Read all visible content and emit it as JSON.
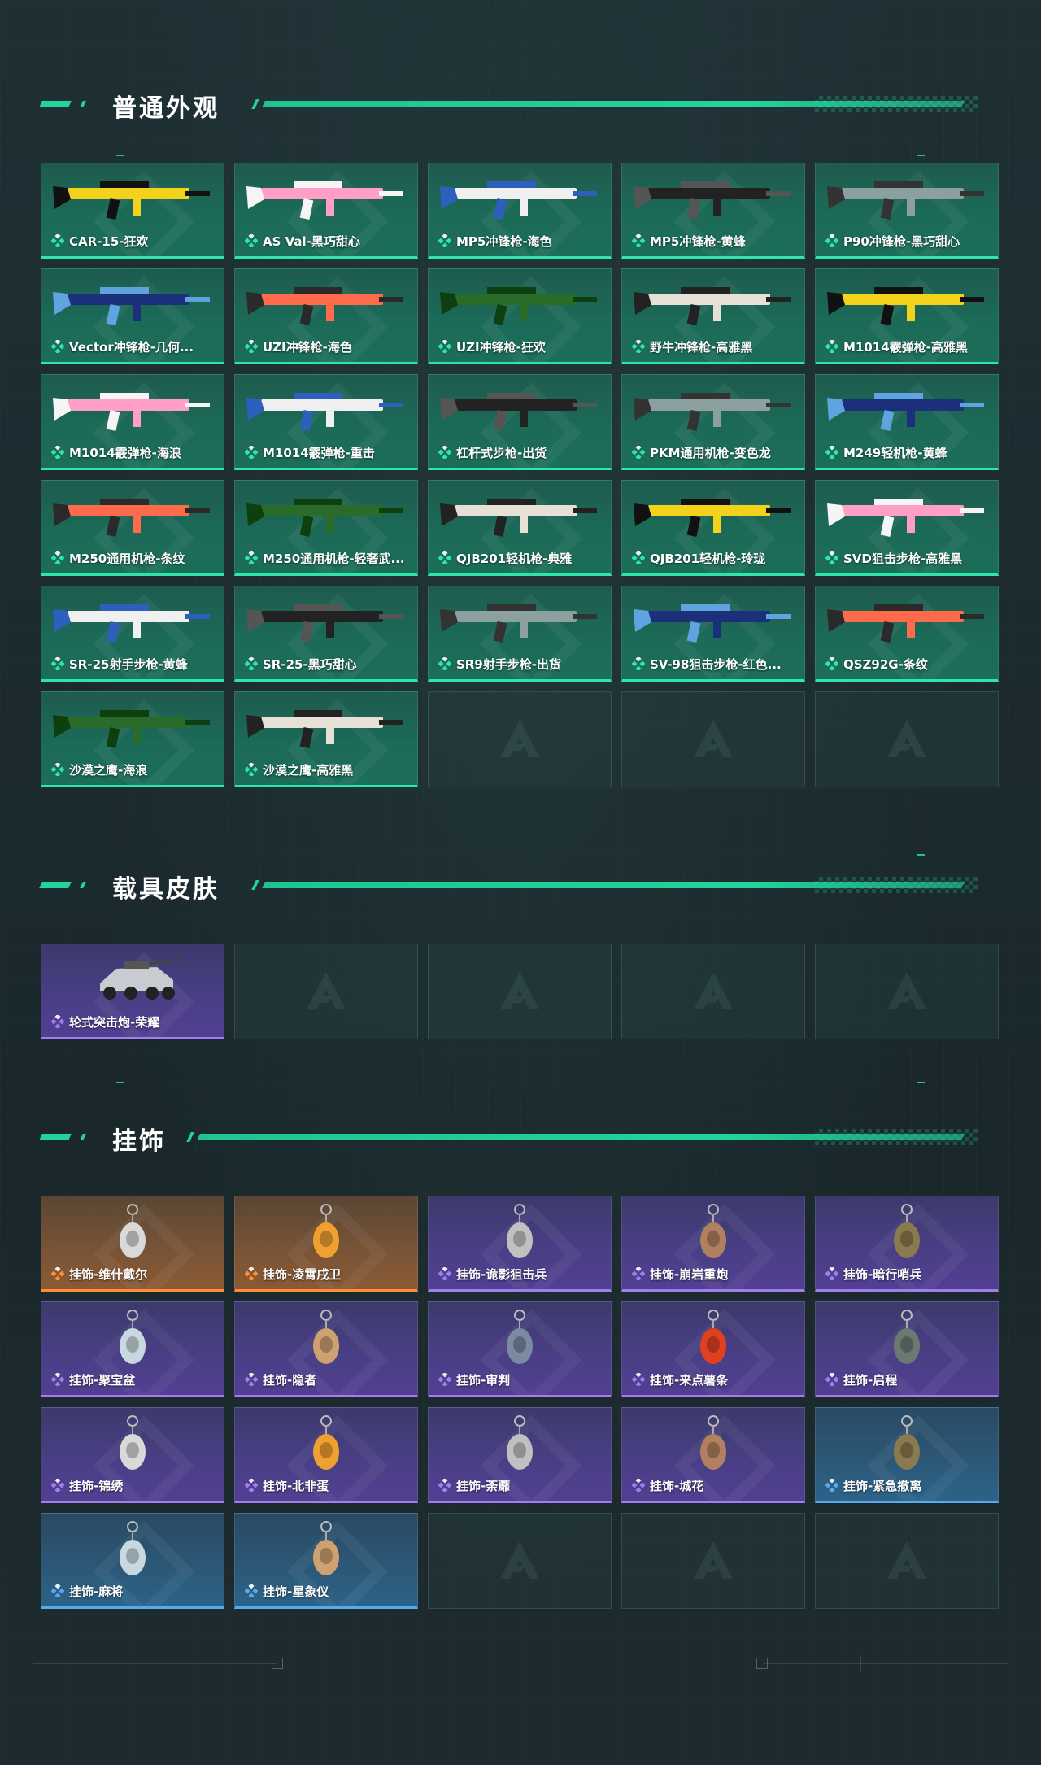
{
  "sections": [
    {
      "title": "普通外观",
      "items": [
        {
          "label": "CAR-15-狂欢",
          "rarity": "green"
        },
        {
          "label": "AS Val-黑巧甜心",
          "rarity": "green"
        },
        {
          "label": "MP5冲锋枪-海色",
          "rarity": "green"
        },
        {
          "label": "MP5冲锋枪-黄蜂",
          "rarity": "green"
        },
        {
          "label": "P90冲锋枪-黑巧甜心",
          "rarity": "green"
        },
        {
          "label": "Vector冲锋枪-几何...",
          "rarity": "green"
        },
        {
          "label": "UZI冲锋枪-海色",
          "rarity": "green"
        },
        {
          "label": "UZI冲锋枪-狂欢",
          "rarity": "green"
        },
        {
          "label": "野牛冲锋枪-高雅黑",
          "rarity": "green"
        },
        {
          "label": "M1014霰弹枪-高雅黑",
          "rarity": "green"
        },
        {
          "label": "M1014霰弹枪-海浪",
          "rarity": "green"
        },
        {
          "label": "M1014霰弹枪-重击",
          "rarity": "green"
        },
        {
          "label": "杠杆式步枪-出货",
          "rarity": "green"
        },
        {
          "label": "PKM通用机枪-变色龙",
          "rarity": "green"
        },
        {
          "label": "M249轻机枪-黄蜂",
          "rarity": "green"
        },
        {
          "label": "M250通用机枪-条纹",
          "rarity": "green"
        },
        {
          "label": "M250通用机枪-轻奢武...",
          "rarity": "green"
        },
        {
          "label": "QJB201轻机枪-典雅",
          "rarity": "green"
        },
        {
          "label": "QJB201轻机枪-玲珑",
          "rarity": "green"
        },
        {
          "label": "SVD狙击步枪-高雅黑",
          "rarity": "green"
        },
        {
          "label": "SR-25射手步枪-黄蜂",
          "rarity": "green"
        },
        {
          "label": "SR-25-黑巧甜心",
          "rarity": "green"
        },
        {
          "label": "SR9射手步枪-出货",
          "rarity": "green"
        },
        {
          "label": "SV-98狙击步枪-红色...",
          "rarity": "green"
        },
        {
          "label": "QSZ92G-条纹",
          "rarity": "green"
        },
        {
          "label": "沙漠之鹰-海浪",
          "rarity": "green"
        },
        {
          "label": "沙漠之鹰-高雅黑",
          "rarity": "green"
        },
        {
          "label": "",
          "rarity": "empty"
        },
        {
          "label": "",
          "rarity": "empty"
        },
        {
          "label": "",
          "rarity": "empty"
        }
      ]
    },
    {
      "title": "载具皮肤",
      "items": [
        {
          "label": "轮式突击炮-荣耀",
          "rarity": "purple"
        },
        {
          "label": "",
          "rarity": "empty"
        },
        {
          "label": "",
          "rarity": "empty"
        },
        {
          "label": "",
          "rarity": "empty"
        },
        {
          "label": "",
          "rarity": "empty"
        }
      ]
    },
    {
      "title": "挂饰",
      "items": [
        {
          "label": "挂饰-维什戴尔",
          "rarity": "orange"
        },
        {
          "label": "挂饰-凌霄戌卫",
          "rarity": "orange"
        },
        {
          "label": "挂饰-诡影狙击兵",
          "rarity": "purple"
        },
        {
          "label": "挂饰-崩岩重炮",
          "rarity": "purple"
        },
        {
          "label": "挂饰-暗行哨兵",
          "rarity": "purple"
        },
        {
          "label": "挂饰-聚宝盆",
          "rarity": "purple"
        },
        {
          "label": "挂饰-隐者",
          "rarity": "purple"
        },
        {
          "label": "挂饰-审判",
          "rarity": "purple"
        },
        {
          "label": "挂饰-来点薯条",
          "rarity": "purple"
        },
        {
          "label": "挂饰-启程",
          "rarity": "purple"
        },
        {
          "label": "挂饰-锦绣",
          "rarity": "purple"
        },
        {
          "label": "挂饰-北非蛋",
          "rarity": "purple"
        },
        {
          "label": "挂饰-荼蘼",
          "rarity": "purple"
        },
        {
          "label": "挂饰-城花",
          "rarity": "purple"
        },
        {
          "label": "挂饰-紧急撤离",
          "rarity": "blue"
        },
        {
          "label": "挂饰-麻将",
          "rarity": "blue"
        },
        {
          "label": "挂饰-星象仪",
          "rarity": "blue"
        },
        {
          "label": "",
          "rarity": "empty"
        },
        {
          "label": "",
          "rarity": "empty"
        },
        {
          "label": "",
          "rarity": "empty"
        }
      ]
    }
  ],
  "colors": {
    "accent": "#23d49a",
    "green": "#2ee6a8",
    "purple": "#a07ef0",
    "orange": "#ff8d3b",
    "blue": "#5aa8f0"
  },
  "icons": {
    "rarity": "diamond-cluster-icon",
    "empty_slot": "brand-triangle-logo-icon"
  }
}
